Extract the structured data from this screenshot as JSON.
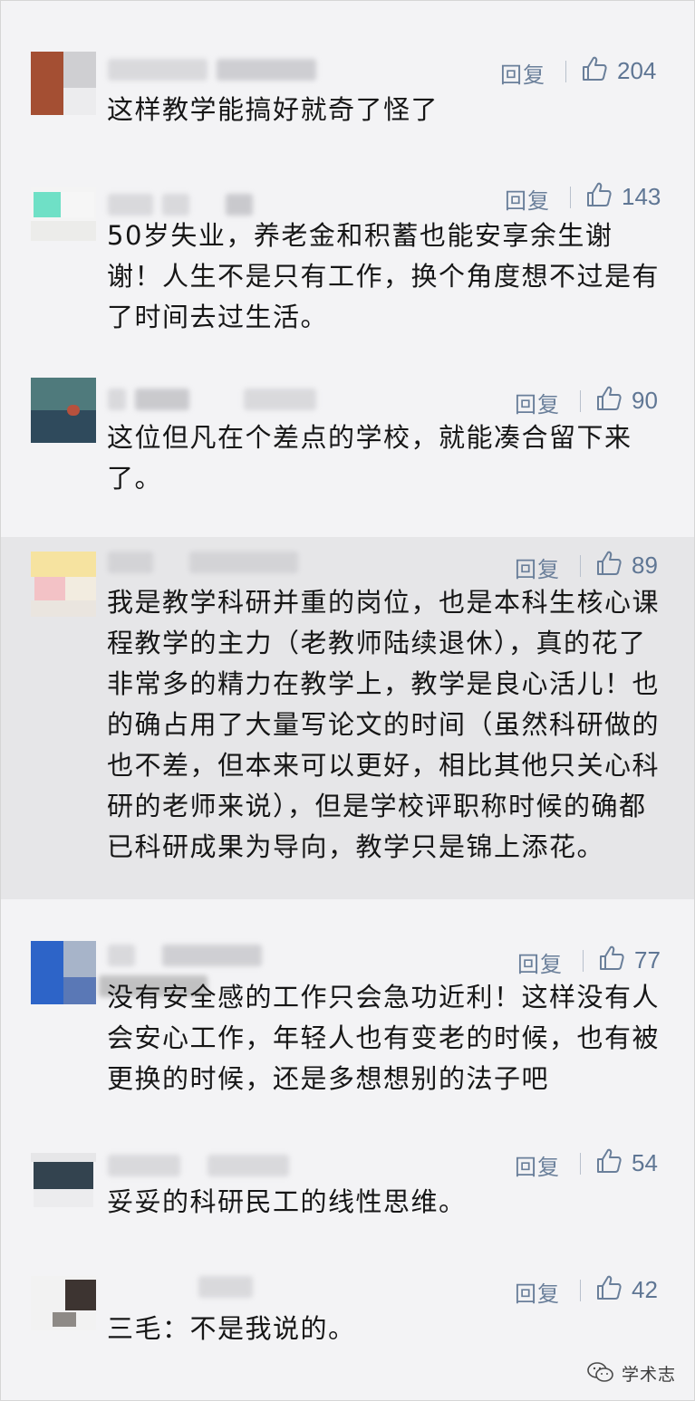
{
  "comments": [
    {
      "reply_label": "回复",
      "likes": "204",
      "text": "这样教学能搞好就奇了怪了"
    },
    {
      "reply_label": "回复",
      "likes": "143",
      "text": "50岁失业，养老金和积蓄也能安享余生谢谢！人生不是只有工作，换个角度想不过是有了时间去过生活。"
    },
    {
      "reply_label": "回复",
      "likes": "90",
      "text": "这位但凡在个差点的学校，就能凑合留下来了。"
    },
    {
      "reply_label": "回复",
      "likes": "89",
      "text": "我是教学科研并重的岗位，也是本科生核心课程教学的主力（老教师陆续退休），真的花了非常多的精力在教学上，教学是良心活儿！也的确占用了大量写论文的时间（虽然科研做的也不差，但本来可以更好，相比其他只关心科研的老师来说），但是学校评职称时候的确都已科研成果为导向，教学只是锦上添花。"
    },
    {
      "reply_label": "回复",
      "likes": "77",
      "text": "没有安全感的工作只会急功近利！这样没有人会安心工作，年轻人也有变老的时候，也有被更换的时候，还是多想想别的法子吧"
    },
    {
      "reply_label": "回复",
      "likes": "54",
      "text": "妥妥的科研民工的线性思维。"
    },
    {
      "reply_label": "回复",
      "likes": "42",
      "text": "三毛：不是我说的。"
    }
  ],
  "watermark": {
    "text": "学术志",
    "icon": "wechat-icon"
  },
  "colors": {
    "background": "#f3f3f5",
    "highlight": "#e6e6e8",
    "reply_text": "#6a7f9a",
    "like_count": "#5f7694",
    "body_text": "#161616"
  }
}
